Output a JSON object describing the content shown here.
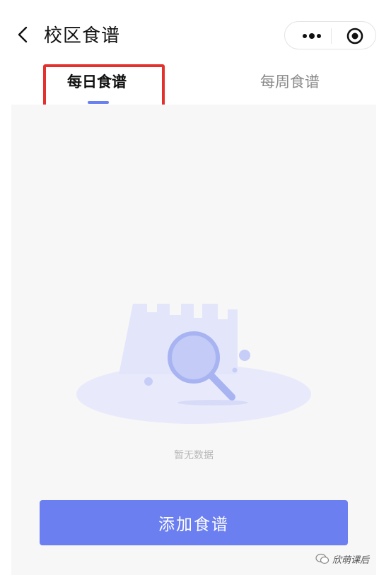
{
  "nav": {
    "title": "校区食谱",
    "back_icon": "chevron-left-icon",
    "more_icon": "more-dots-icon",
    "record_icon": "record-circle-icon"
  },
  "tabs": [
    {
      "label": "每日食谱",
      "active": true
    },
    {
      "label": "每周食谱",
      "active": false
    }
  ],
  "empty_state": {
    "text": "暂无数据",
    "illustration": "magnifier-empty-illustration"
  },
  "add_button": {
    "label": "添加食谱"
  },
  "watermark": {
    "text": "欣萌课后",
    "icon": "wechat-icon"
  },
  "colors": {
    "accent": "#6b7ff0",
    "highlight": "#e5312e",
    "background": "#f7f7f7"
  }
}
